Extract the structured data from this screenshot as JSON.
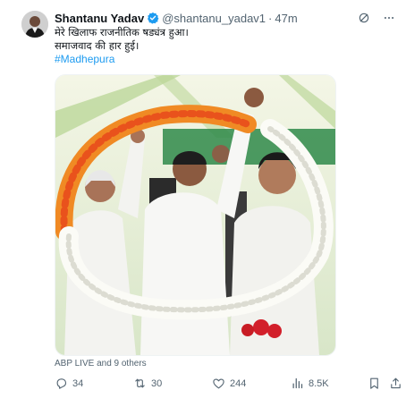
{
  "author": {
    "name": "Shantanu Yadav",
    "handle": "@shantanu_yadav1",
    "separator": "·",
    "time": "47m",
    "verified_color": "#1d9bf0"
  },
  "tweet": {
    "line1": "मेरे खिलाफ राजनीतिक षड्यंत्र हुआ।",
    "line2": "समाजवाद की हार हुई।",
    "hashtag": "#Madhepura"
  },
  "media": {
    "attribution": "ABP LIVE and 9 others"
  },
  "actions": {
    "replies": "34",
    "retweets": "30",
    "likes": "244",
    "views": "8.5K"
  },
  "icons": [
    "grok-icon",
    "more-icon",
    "reply-icon",
    "retweet-icon",
    "like-icon",
    "views-icon",
    "bookmark-icon",
    "share-icon",
    "verified-badge-icon"
  ]
}
